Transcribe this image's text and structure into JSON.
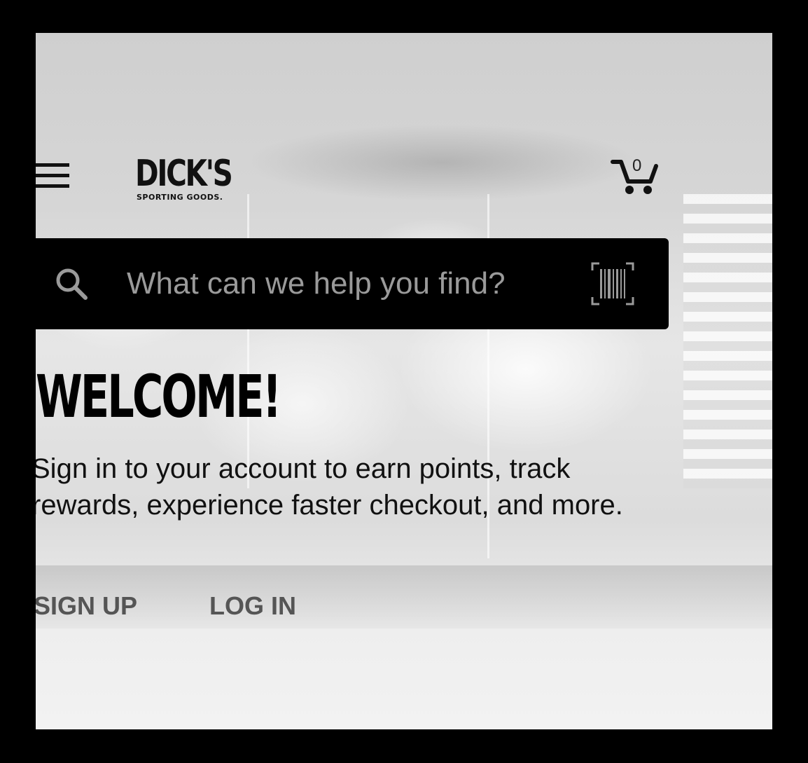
{
  "header": {
    "logo_main": "DICK'S",
    "logo_sub": "SPORTING GOODS.",
    "cart_count": "0"
  },
  "search": {
    "placeholder": "What can we help you find?"
  },
  "welcome": {
    "title": "WELCOME!",
    "message": "Sign in to your account to earn points, track rewards, experience faster checkout, and more."
  },
  "actions": {
    "sign_up": "SIGN UP",
    "log_in": "LOG IN"
  },
  "icons": {
    "menu": "hamburger-menu-icon",
    "cart": "shopping-cart-icon",
    "search": "search-icon",
    "barcode": "barcode-scan-icon"
  },
  "colors": {
    "search_bar_bg": "#000000",
    "placeholder": "#9a9a9a",
    "action_text": "#555555"
  }
}
